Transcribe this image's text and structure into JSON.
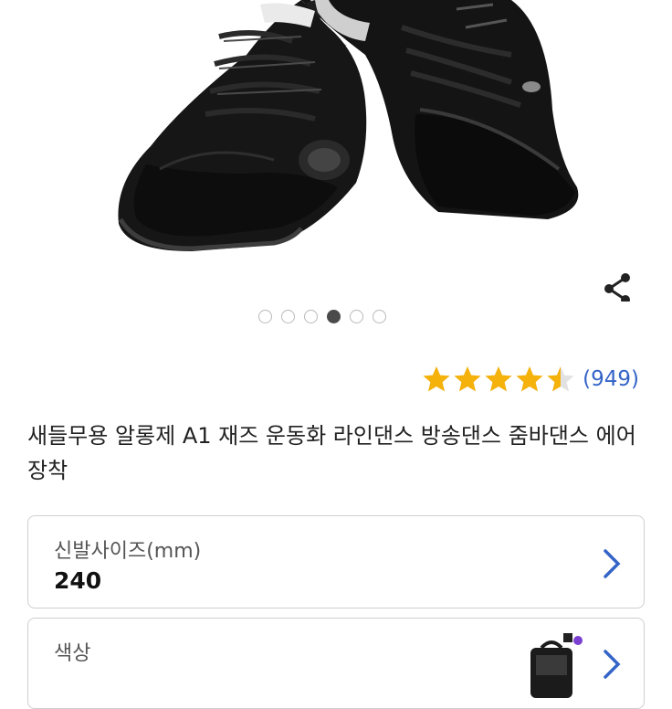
{
  "gallery": {
    "image_alt": "black dance sneakers",
    "dot_count": 6,
    "active_index": 3
  },
  "rating": {
    "stars": 4.5,
    "count_text": "(949)",
    "star_color": "#f5b20b",
    "link_color": "#3464c8"
  },
  "product": {
    "title": "새들무용 알롱제 A1 재즈 운동화 라인댄스 방송댄스 줌바댄스 에어장착"
  },
  "options": [
    {
      "label": "신발사이즈(mm)",
      "value": "240"
    },
    {
      "label": "색상",
      "value": ""
    }
  ],
  "icons": {
    "share": "share-icon",
    "chevron": "chevron-right-icon",
    "star": "star-icon"
  }
}
